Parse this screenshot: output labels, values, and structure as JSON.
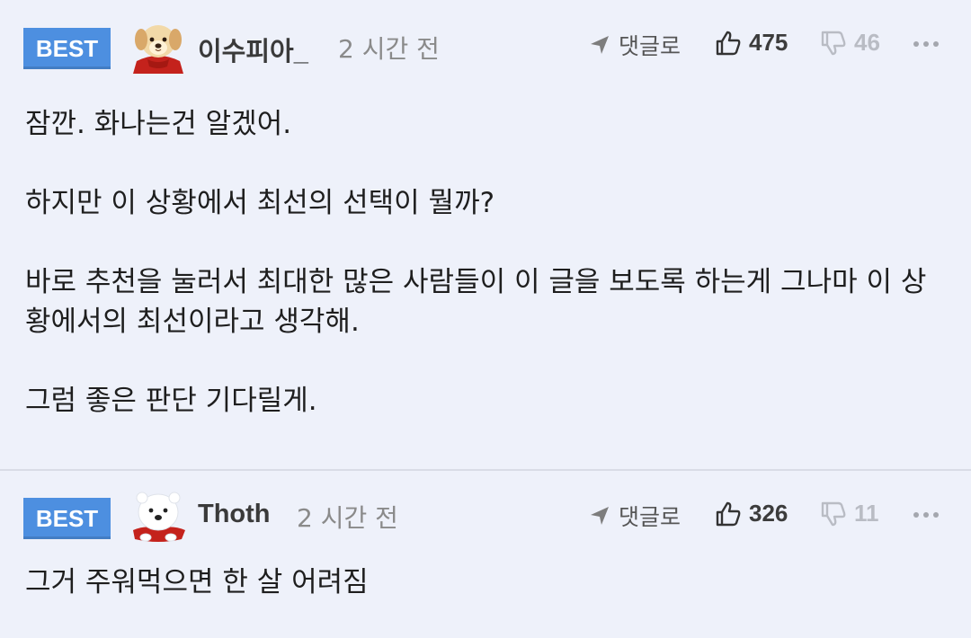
{
  "colors": {
    "background": "#eef1fa",
    "best_badge": "#4d8fe0",
    "divider": "#d9dce6"
  },
  "comments": [
    {
      "badge": "BEST",
      "avatar_icon": "puppy-avatar-icon",
      "nickname": "이수피아_",
      "time": "2 시간 전",
      "reply_label": "댓글로",
      "upvotes": "475",
      "downvotes": "46",
      "paragraphs": [
        "잠깐. 화나는건 알겠어.",
        "하지만 이 상황에서 최선의 선택이 뭘까?",
        "바로 추천을 눌러서 최대한 많은 사람들이 이 글을 보도록 하는게 그나마 이 상황에서의 최선이라고 생각해.",
        "그럼 좋은 판단 기다릴게."
      ]
    },
    {
      "badge": "BEST",
      "avatar_icon": "polar-bear-avatar-icon",
      "nickname": "Thoth",
      "time": "2 시간 전",
      "reply_label": "댓글로",
      "upvotes": "326",
      "downvotes": "11",
      "paragraphs": [
        "그거 주워먹으면 한 살 어려짐"
      ]
    }
  ]
}
